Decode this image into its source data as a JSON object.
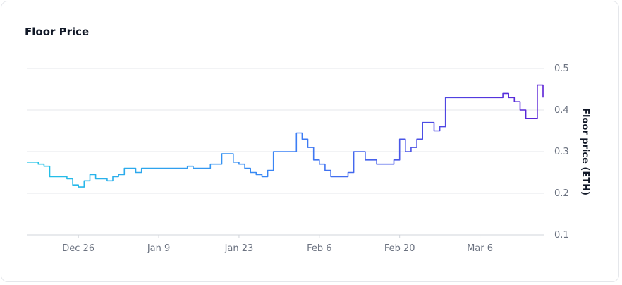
{
  "card": {
    "title": "Floor Price"
  },
  "chart_data": {
    "type": "line",
    "title": "Floor Price",
    "xlabel": "",
    "ylabel": "Floor price (ETH)",
    "x_ticks": [
      "Dec 26",
      "Jan 9",
      "Jan 23",
      "Feb 6",
      "Feb 20",
      "Mar 6"
    ],
    "y_ticks": [
      0.1,
      0.2,
      0.3,
      0.4,
      0.5
    ],
    "ylim": [
      0.1,
      0.5
    ],
    "y_axis_side": "right",
    "grid": "horizontal",
    "x_start": "Dec 17",
    "x_end": "Mar 17",
    "line_gradient": [
      "#22c5e6",
      "#3b82f6",
      "#5b21d6"
    ],
    "series": [
      {
        "x": [
          "Dec 17",
          "Dec 18",
          "Dec 19",
          "Dec 20",
          "Dec 21",
          "Dec 22",
          "Dec 23",
          "Dec 24",
          "Dec 25",
          "Dec 26",
          "Dec 27",
          "Dec 28",
          "Dec 29",
          "Dec 30",
          "Dec 31",
          "Jan 1",
          "Jan 2",
          "Jan 3",
          "Jan 4",
          "Jan 5",
          "Jan 6",
          "Jan 7",
          "Jan 8",
          "Jan 9",
          "Jan 10",
          "Jan 11",
          "Jan 12",
          "Jan 13",
          "Jan 14",
          "Jan 15",
          "Jan 16",
          "Jan 17",
          "Jan 18",
          "Jan 19",
          "Jan 20",
          "Jan 21",
          "Jan 22",
          "Jan 23",
          "Jan 24",
          "Jan 25",
          "Jan 26",
          "Jan 27",
          "Jan 28",
          "Jan 29",
          "Jan 30",
          "Jan 31",
          "Feb 1",
          "Feb 2",
          "Feb 3",
          "Feb 4",
          "Feb 5",
          "Feb 6",
          "Feb 7",
          "Feb 8",
          "Feb 9",
          "Feb 10",
          "Feb 11",
          "Feb 12",
          "Feb 13",
          "Feb 14",
          "Feb 15",
          "Feb 16",
          "Feb 17",
          "Feb 18",
          "Feb 19",
          "Feb 20",
          "Feb 21",
          "Feb 22",
          "Feb 23",
          "Feb 24",
          "Feb 25",
          "Feb 26",
          "Feb 27",
          "Feb 28",
          "Mar 1",
          "Mar 2",
          "Mar 3",
          "Mar 4",
          "Mar 5",
          "Mar 6",
          "Mar 7",
          "Mar 8",
          "Mar 9",
          "Mar 10",
          "Mar 11",
          "Mar 12",
          "Mar 13",
          "Mar 14",
          "Mar 15",
          "Mar 16",
          "Mar 17"
        ],
        "values": [
          0.275,
          0.275,
          0.27,
          0.265,
          0.24,
          0.24,
          0.24,
          0.235,
          0.22,
          0.215,
          0.23,
          0.245,
          0.235,
          0.235,
          0.23,
          0.24,
          0.245,
          0.26,
          0.26,
          0.25,
          0.26,
          0.26,
          0.26,
          0.26,
          0.26,
          0.26,
          0.26,
          0.26,
          0.265,
          0.26,
          0.26,
          0.26,
          0.27,
          0.27,
          0.295,
          0.295,
          0.275,
          0.27,
          0.26,
          0.25,
          0.245,
          0.24,
          0.255,
          0.3,
          0.3,
          0.3,
          0.3,
          0.345,
          0.33,
          0.31,
          0.28,
          0.27,
          0.255,
          0.24,
          0.24,
          0.24,
          0.25,
          0.3,
          0.3,
          0.28,
          0.28,
          0.27,
          0.27,
          0.27,
          0.28,
          0.33,
          0.3,
          0.31,
          0.33,
          0.37,
          0.37,
          0.35,
          0.36,
          0.43,
          0.43,
          0.43,
          0.43,
          0.43,
          0.43,
          0.43,
          0.43,
          0.43,
          0.43,
          0.44,
          0.43,
          0.42,
          0.4,
          0.38,
          0.38,
          0.46,
          0.43
        ]
      }
    ]
  }
}
